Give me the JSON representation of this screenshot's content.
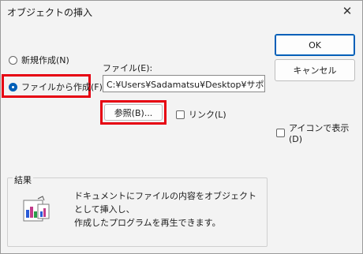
{
  "dialog": {
    "title": "オブジェクトの挿入",
    "close_glyph": "✕"
  },
  "options": {
    "new_label": "新規作成(N)",
    "from_file_label": "ファイルから作成(F)",
    "selected": "from_file"
  },
  "file": {
    "label": "ファイル(E):",
    "value": "C:¥Users¥Sadamatsu¥Desktop¥サポート業",
    "browse_label": "参照(B)...",
    "link_label": "リンク(L)",
    "link_checked": false
  },
  "buttons": {
    "ok_label": "OK",
    "cancel_label": "キャンセル"
  },
  "display_icon": {
    "label": "アイコンで表示(D)",
    "checked": false
  },
  "result": {
    "title": "結果",
    "line1": "ドキュメントにファイルの内容をオブジェクトとして挿入し、",
    "line2": "作成したプログラムを再生できます。"
  },
  "colors": {
    "highlight": "#e60012",
    "accent": "#005fb8"
  }
}
